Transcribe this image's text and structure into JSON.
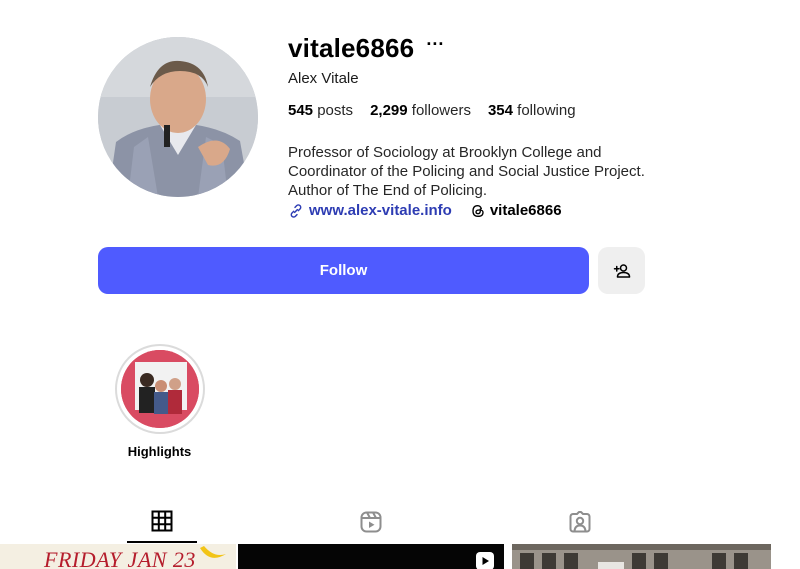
{
  "profile": {
    "username": "vitale6866",
    "more_label": "···",
    "full_name": "Alex Vitale",
    "stats": {
      "posts_count": "545",
      "posts_label": "posts",
      "followers_count": "2,299",
      "followers_label": "followers",
      "following_count": "354",
      "following_label": "following"
    },
    "bio": [
      "Professor of Sociology at Brooklyn College and",
      "Coordinator of the Policing and Social Justice Project.",
      "Author of The End of Policing."
    ],
    "website": "www.alex-vitale.info",
    "threads_handle": "vitale6866"
  },
  "actions": {
    "follow_label": "Follow",
    "add_user_icon": "add-user-icon"
  },
  "highlights": [
    {
      "label": "Highlights"
    }
  ],
  "tabs": [
    {
      "icon": "grid-icon",
      "active": true
    },
    {
      "icon": "reels-icon",
      "active": false
    },
    {
      "icon": "tagged-icon",
      "active": false
    }
  ],
  "posts": [
    {
      "text": "FRIDAY JAN 23"
    },
    {
      "icon": "reel-icon"
    },
    {
      "icon": "none"
    }
  ],
  "colors": {
    "follow_button": "#4f5bff",
    "link": "#2d3cb3",
    "secondary_button": "#efefef"
  }
}
